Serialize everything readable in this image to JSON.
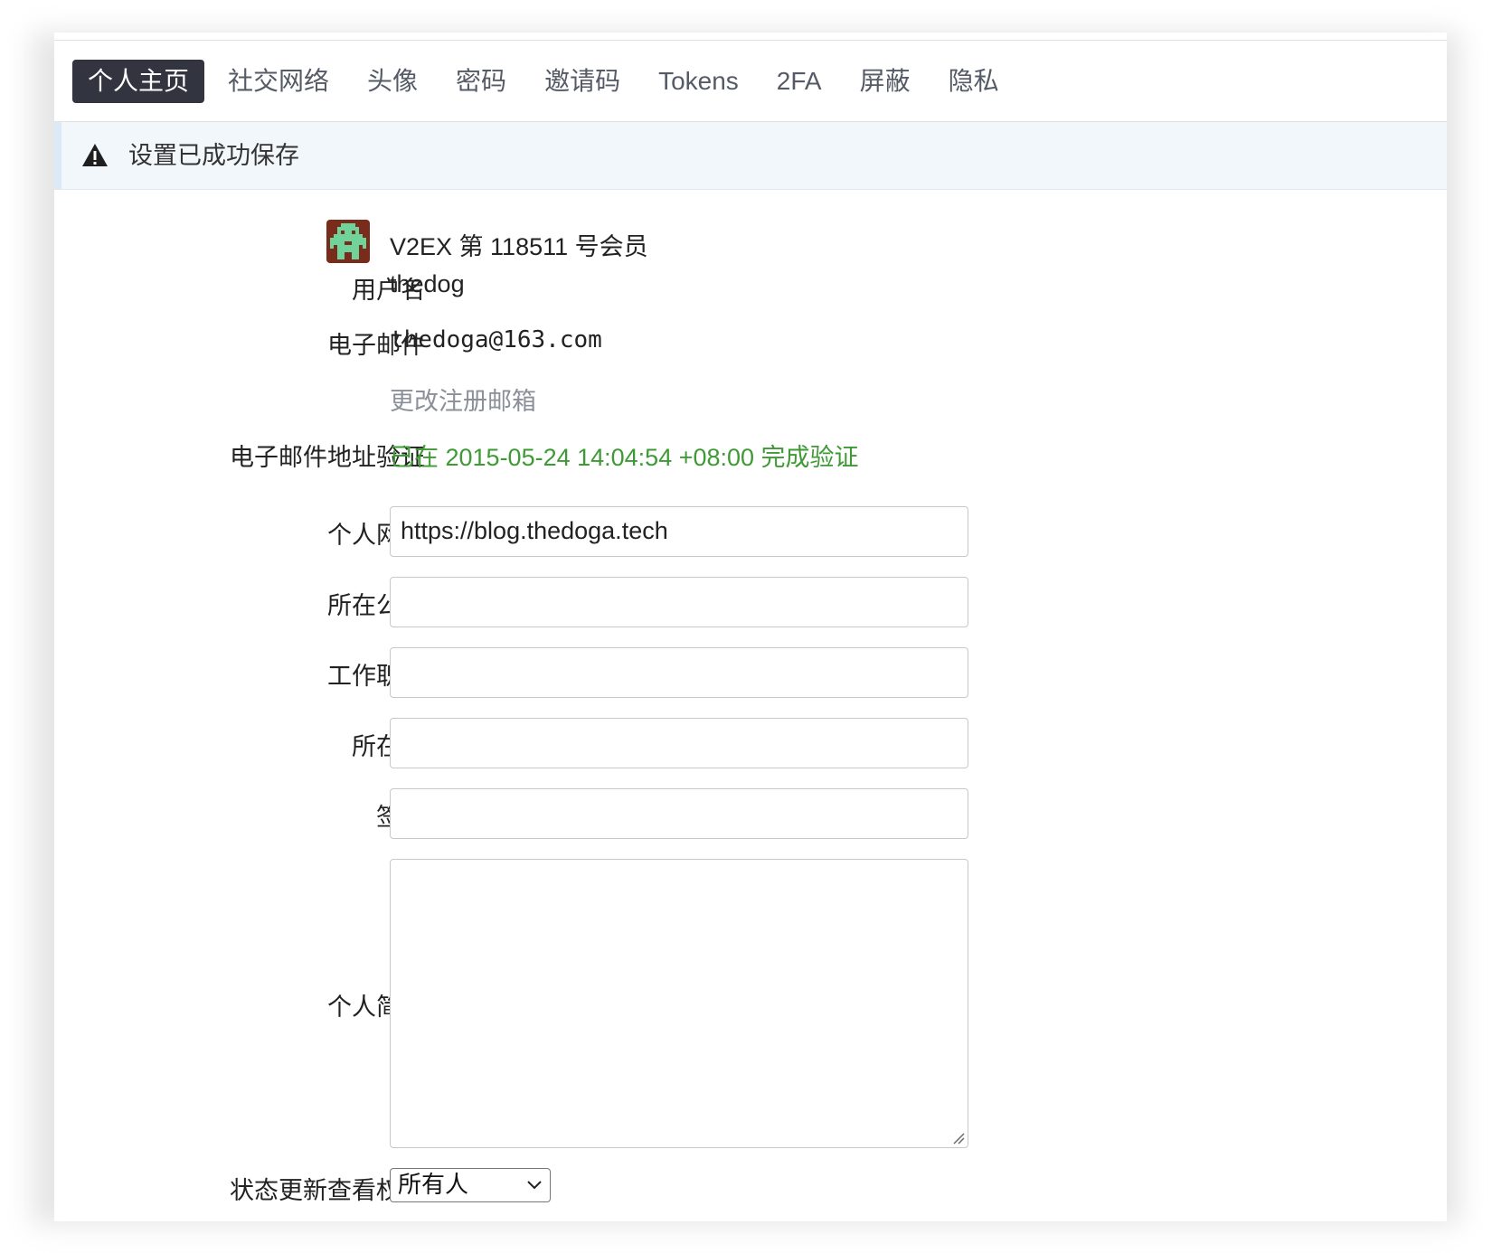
{
  "tabs": [
    {
      "label": "个人主页",
      "active": true
    },
    {
      "label": "社交网络",
      "active": false
    },
    {
      "label": "头像",
      "active": false
    },
    {
      "label": "密码",
      "active": false
    },
    {
      "label": "邀请码",
      "active": false
    },
    {
      "label": "Tokens",
      "active": false
    },
    {
      "label": "2FA",
      "active": false
    },
    {
      "label": "屏蔽",
      "active": false
    },
    {
      "label": "隐私",
      "active": false
    }
  ],
  "notice": {
    "icon": "warning-icon",
    "text": "设置已成功保存"
  },
  "profile": {
    "member_text": "V2EX 第 118511 号会员",
    "username_label": "用户名",
    "username": "thedog",
    "email_label": "电子邮件",
    "email": "thedoga@163.com",
    "change_email_link": "更改注册邮箱",
    "verify_label": "电子邮件地址验证",
    "verify_status": "已在 2015-05-24 14:04:54 +08:00 完成验证"
  },
  "form": {
    "website_label": "个人网站",
    "website_value": "https://blog.thedoga.tech",
    "company_label": "所在公司",
    "company_value": "",
    "job_label": "工作职位",
    "job_value": "",
    "location_label": "所在地",
    "location_value": "",
    "signature_label": "签名",
    "signature_value": "",
    "bio_label": "个人简介",
    "bio_value": "",
    "status_visibility_label": "状态更新查看权限",
    "status_visibility_value": "所有人"
  },
  "colors": {
    "active_tab_bg": "#32343f",
    "notice_bg": "#f2f7fc",
    "verified_green": "#3e9a34",
    "link_gray": "#8a8f99"
  }
}
